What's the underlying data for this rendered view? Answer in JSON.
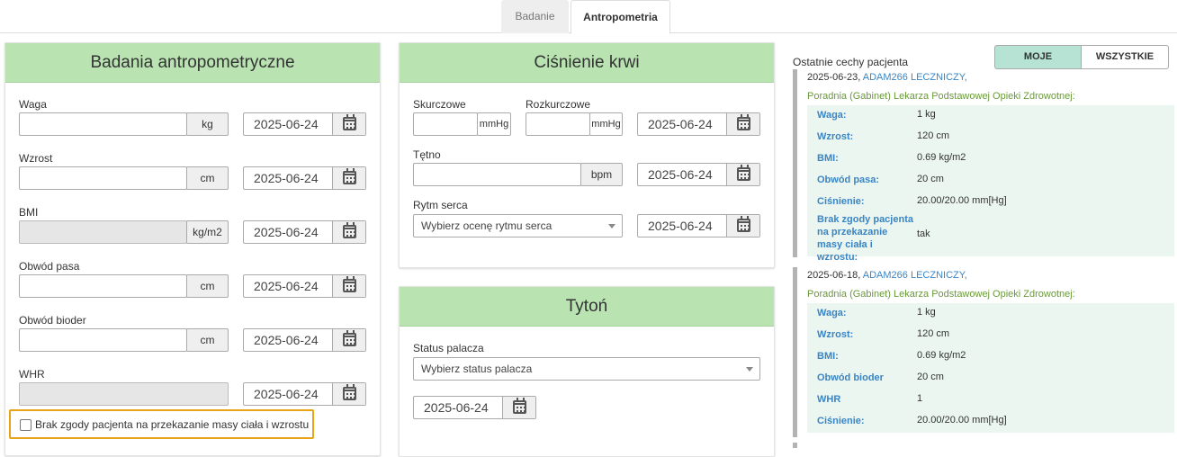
{
  "tabs": {
    "badanie": "Badanie",
    "antropometria": "Antropometria"
  },
  "anthro": {
    "title": "Badania antropometryczne",
    "fields": {
      "waga": {
        "label": "Waga",
        "unit": "kg",
        "date": "2025-06-24"
      },
      "wzrost": {
        "label": "Wzrost",
        "unit": "cm",
        "date": "2025-06-24"
      },
      "bmi": {
        "label": "BMI",
        "unit": "kg/m2",
        "date": "2025-06-24"
      },
      "pas": {
        "label": "Obwód pasa",
        "unit": "cm",
        "date": "2025-06-24"
      },
      "biodra": {
        "label": "Obwód bioder",
        "unit": "cm",
        "date": "2025-06-24"
      },
      "whr": {
        "label": "WHR",
        "date": "2025-06-24"
      }
    },
    "consent": "Brak zgody pacjenta na przekazanie masy ciała i wzrostu"
  },
  "blood": {
    "title": "Ciśnienie krwi",
    "skurczowe": {
      "label": "Skurczowe",
      "unit": "mmHg"
    },
    "rozkurczowe": {
      "label": "Rozkurczowe",
      "unit": "mmHg"
    },
    "pressure_date": "2025-06-24",
    "tetno": {
      "label": "Tętno",
      "unit": "bpm",
      "date": "2025-06-24"
    },
    "rytm": {
      "label": "Rytm serca",
      "placeholder": "Wybierz ocenę rytmu serca",
      "date": "2025-06-24"
    }
  },
  "tobacco": {
    "title": "Tytoń",
    "status_label": "Status palacza",
    "placeholder": "Wybierz status palacza",
    "date": "2025-06-24"
  },
  "recent": {
    "title": "Ostatnie cechy pacjenta",
    "toggle_moje": "MOJE",
    "toggle_all": "WSZYSTKIE",
    "entries": [
      {
        "date": "2025-06-23,",
        "doctor": "ADAM266 LECZNICZY,",
        "clinic": "Poradnia (Gabinet) Lekarza Podstawowej Opieki Zdrowotnej:",
        "rows": [
          {
            "k": "Waga:",
            "v": "1 kg"
          },
          {
            "k": "Wzrost:",
            "v": "120 cm"
          },
          {
            "k": "BMI:",
            "v": "0.69 kg/m2"
          },
          {
            "k": "Obwód pasa:",
            "v": "20 cm"
          },
          {
            "k": "Ciśnienie:",
            "v": "20.00/20.00 mm[Hg]"
          },
          {
            "k": "Brak zgody pacjenta na przekazanie masy ciała i wzrostu:",
            "v": "tak"
          }
        ]
      },
      {
        "date": "2025-06-18,",
        "doctor": "ADAM266 LECZNICZY,",
        "clinic": "Poradnia (Gabinet) Lekarza Podstawowej Opieki Zdrowotnej:",
        "rows": [
          {
            "k": "Waga:",
            "v": "1 kg"
          },
          {
            "k": "Wzrost:",
            "v": "120 cm"
          },
          {
            "k": "BMI:",
            "v": "0.69 kg/m2"
          },
          {
            "k": "Obwód bioder",
            "v": "20 cm"
          },
          {
            "k": "WHR",
            "v": "1"
          },
          {
            "k": "Ciśnienie:",
            "v": "20.00/20.00 mm[Hg]"
          }
        ]
      }
    ]
  }
}
